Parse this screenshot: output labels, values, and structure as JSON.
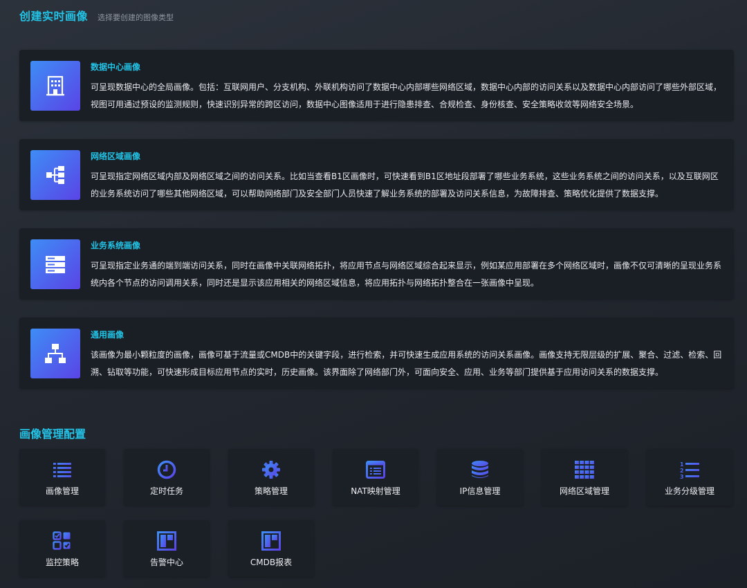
{
  "header": {
    "title": "创建实时画像",
    "subtitle": "选择要创建的图像类型"
  },
  "cards": [
    {
      "title": "数据中心画像",
      "icon": "building-icon",
      "desc": "可呈现数据中心的全局画像。包括：互联网用户、分支机构、外联机构访问了数据中心内部哪些网络区域，数据中心内部的访问关系以及数据中心内部访问了哪些外部区域，视图可用通过预设的监测规则，快速识别异常的跨区访问，数据中心图像适用于进行隐患排查、合规检查、身份核查、安全策略收敛等网络安全场景。"
    },
    {
      "title": "网络区域画像",
      "icon": "network-tree-icon",
      "desc": "可呈现指定网络区域内部及网络区域之间的访问关系。比如当查看B1区画像时，可快速看到B1区地址段部署了哪些业务系统，这些业务系统之间的访问关系，以及互联网区的业务系统访问了哪些其他网络区域，可以帮助网络部门及安全部门人员快速了解业务系统的部署及访问关系信息，为故障排查、策略优化提供了数据支撑。"
    },
    {
      "title": "业务系统画像",
      "icon": "server-icon",
      "desc": "可呈现指定业务通的端到端访问关系，同时在画像中关联网络拓扑，将应用节点与网络区域综合起来显示，例如某应用部署在多个网络区域时，画像不仅可清晰的呈现业务系统内各个节点的访问调用关系，同时还是显示该应用相关的网络区域信息，将应用拓扑与网络拓扑整合在一张画像中呈现。"
    },
    {
      "title": "通用画像",
      "icon": "hierarchy-icon",
      "desc": "该画像为最小颗粒度的画像，画像可基于流量或CMDB中的关键字段，进行检索，并可快速生成应用系统的访问关系画像。画像支持无限层级的扩展、聚合、过滤、检索、回溯、钻取等功能，可快速形成目标应用节点的实时，历史画像。该界面除了网络部门外，可面向安全、应用、业务等部门提供基于应用访问关系的数据支撑。"
    }
  ],
  "config": {
    "title": "画像管理配置",
    "tiles": [
      {
        "label": "画像管理",
        "icon": "list-icon"
      },
      {
        "label": "定时任务",
        "icon": "clock-icon"
      },
      {
        "label": "策略管理",
        "icon": "gear-icon"
      },
      {
        "label": "NAT映射管理",
        "icon": "window-list-icon"
      },
      {
        "label": "IP信息管理",
        "icon": "database-icon"
      },
      {
        "label": "网络区域管理",
        "icon": "grid-icon"
      },
      {
        "label": "业务分级管理",
        "icon": "numbered-list-icon"
      },
      {
        "label": "监控策略",
        "icon": "checkbox-grid-icon"
      },
      {
        "label": "告警中心",
        "icon": "dashboard-icon"
      },
      {
        "label": "CMDB报表",
        "icon": "report-icon"
      }
    ]
  },
  "colors": {
    "accent": "#22c3e6",
    "icon_gradient_start": "#3e8df6",
    "icon_gradient_end": "#5a44e6",
    "card_bg": "#1a1e25"
  }
}
